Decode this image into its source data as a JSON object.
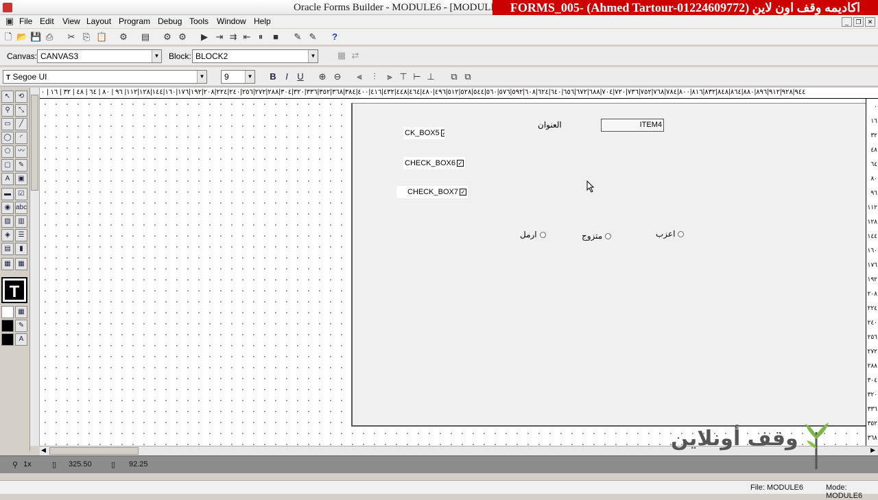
{
  "window": {
    "title": "Oracle Forms Builder - MODULE6 - [MODULE6: C",
    "banner": "اكاديمه وقف اون لاين (Ahmed Tartour-01224609772) -FORMS_005"
  },
  "menu": [
    "File",
    "Edit",
    "View",
    "Layout",
    "Program",
    "Debug",
    "Tools",
    "Window",
    "Help"
  ],
  "toolbar2": {
    "canvas_label": "Canvas:",
    "canvas_value": "CANVAS3",
    "block_label": "Block:",
    "block_value": "BLOCK2"
  },
  "toolbar3": {
    "font_value": "Segoe UI",
    "size_value": "9",
    "bold": "B",
    "italic": "I",
    "underline": "U"
  },
  "ruler_top": "٩٤٤|٩٢٨|٩١٢|٨٩٦|٨٨٠|٨٦٤|٨٤٨|٨٣٢|٨١٦|٨٠٠|٧٨٤|٧٦٨|٧٥٢|٧٣٦|٧٢٠|٧٠٤|٦٨٨|٦٧٢|٦٥٦|٦٤٠|٦٢٤|٦٠٨|٥٩٢|٥٧٦|٥٦٠|٥٤٤|٥٢٨|٥١٢|٤٩٦|٤٨٠|٤٦٤|٤٤٨|٤٣٢|٤١٦|٤٠٠|٣٨٤|٣٦٨|٣٥٢|٣٣٦|٣٢٠|٣٠٤|٢٨٨|٢٧٢|٢٥٦|٢٤٠|٢٢٤|٢٠٨|١٩٢|١٧٦|١٦٠|١٤٤|١٢٨|١١٢| ٩٦ | ٨٠ | ٦٤ | ٤٨ | ٣٢ | ١٦ | ٠",
  "ruler_right": [
    "٠",
    "١٦",
    "٣٢",
    "٤٨",
    "٦٤",
    "٨٠",
    "٩٦",
    "١١٢",
    "١٢٨",
    "١٤٤",
    "١٦٠",
    "١٧٦",
    "١٩٢",
    "٢٠٨",
    "٢٢٤",
    "٢٤٠",
    "٢٥٦",
    "٢٧٢",
    "٢٨٨",
    "٣٠٤",
    "٣٢٠",
    "٣٣٦",
    "٣٥٢",
    "٣٦٨",
    "٣٨٤"
  ],
  "canvas": {
    "label_title": "العنوان",
    "item4": "ITEM4",
    "checkboxes": [
      {
        "label": "CK_BOX5",
        "checked": "✓"
      },
      {
        "label": "CHECK_BOX6",
        "checked": "✓"
      },
      {
        "label": "CHECK_BOX7",
        "checked": "✓"
      }
    ],
    "radios": [
      {
        "label": "ارمل"
      },
      {
        "label": "متزوج"
      },
      {
        "label": "اعزب"
      }
    ]
  },
  "status": {
    "zoom": "1x",
    "x": "325.50",
    "y": "92.25",
    "file": "File: MODULE6",
    "mode": "Mode: MODULE6"
  },
  "logo": {
    "text": "وقف أونلاين"
  }
}
